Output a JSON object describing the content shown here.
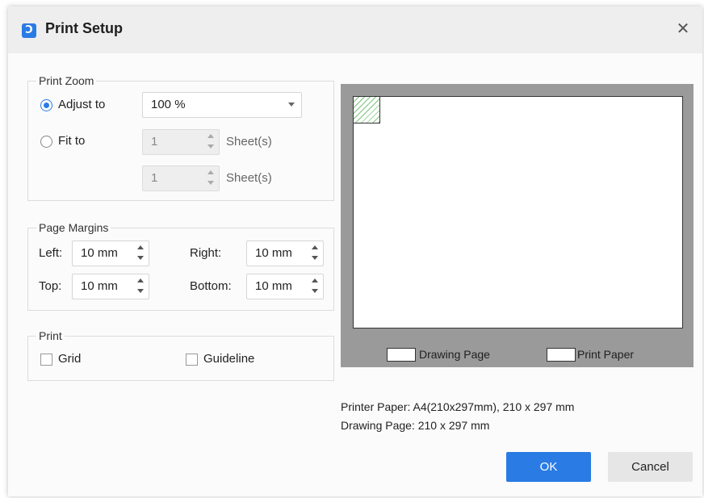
{
  "title": "Print Setup",
  "icons": {
    "app": "app-logo-icon",
    "close": "close-icon"
  },
  "close_glyph": "✕",
  "app_glyph": "Ͻ",
  "print_zoom": {
    "legend": "Print Zoom",
    "adjust_to": {
      "label": "Adjust to",
      "selected": true,
      "value": "100 %"
    },
    "fit_to": {
      "label": "Fit to",
      "selected": false,
      "width": "1",
      "height": "1",
      "unit": "Sheet(s)"
    }
  },
  "page_margins": {
    "legend": "Page Margins",
    "left": {
      "label": "Left:",
      "value": "10 mm"
    },
    "right": {
      "label": "Right:",
      "value": "10 mm"
    },
    "top": {
      "label": "Top:",
      "value": "10 mm"
    },
    "bottom": {
      "label": "Bottom:",
      "value": "10 mm"
    }
  },
  "print": {
    "legend": "Print",
    "grid": {
      "label": "Grid",
      "checked": false
    },
    "guideline": {
      "label": "Guideline",
      "checked": false
    }
  },
  "preview": {
    "legend_drawing_page": "Drawing Page",
    "legend_print_paper": "Print Paper"
  },
  "info": {
    "printer_paper": "Printer Paper: A4(210x297mm), 210 x 297 mm",
    "drawing_page": "Drawing Page: 210 x 297 mm"
  },
  "buttons": {
    "ok": "OK",
    "cancel": "Cancel"
  },
  "colors": {
    "accent": "#2a7be4",
    "preview_bg": "#9a9a9a",
    "hatch": "#7cc47c"
  }
}
